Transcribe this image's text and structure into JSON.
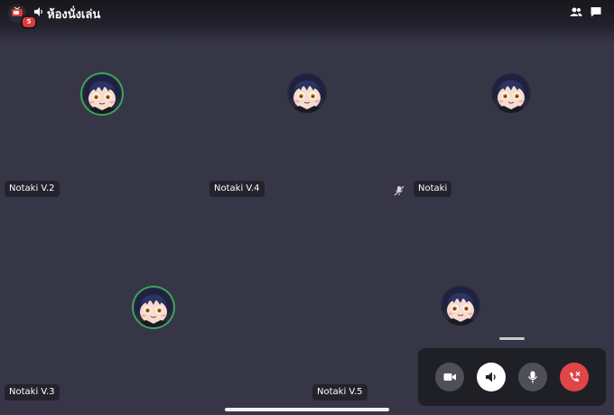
{
  "header": {
    "server_badge": "5",
    "channel_name": "ห้องนั่งเล่น",
    "icons": [
      "tv-icon",
      "speaker-icon",
      "members-icon",
      "chat-icon"
    ]
  },
  "participants": [
    {
      "name": "Notaki V.2",
      "speaking": true,
      "muted": false
    },
    {
      "name": "Notaki V.4",
      "speaking": false,
      "muted": false
    },
    {
      "name": "Notaki",
      "speaking": false,
      "muted": true
    },
    {
      "name": "Notaki V.3",
      "speaking": true,
      "muted": false
    },
    {
      "name": "Notaki V.5",
      "speaking": false,
      "muted": false
    }
  ],
  "controls": {
    "buttons": [
      "camera-icon",
      "speaker-icon",
      "microphone-icon",
      "hang-up-icon"
    ],
    "colors": {
      "panel": "#1f1f26",
      "neutral": "#4f4f58",
      "active": "#ffffff",
      "danger": "#e04646"
    }
  },
  "colors": {
    "background": "#373647",
    "speaking_ring": "#3ba55d"
  }
}
